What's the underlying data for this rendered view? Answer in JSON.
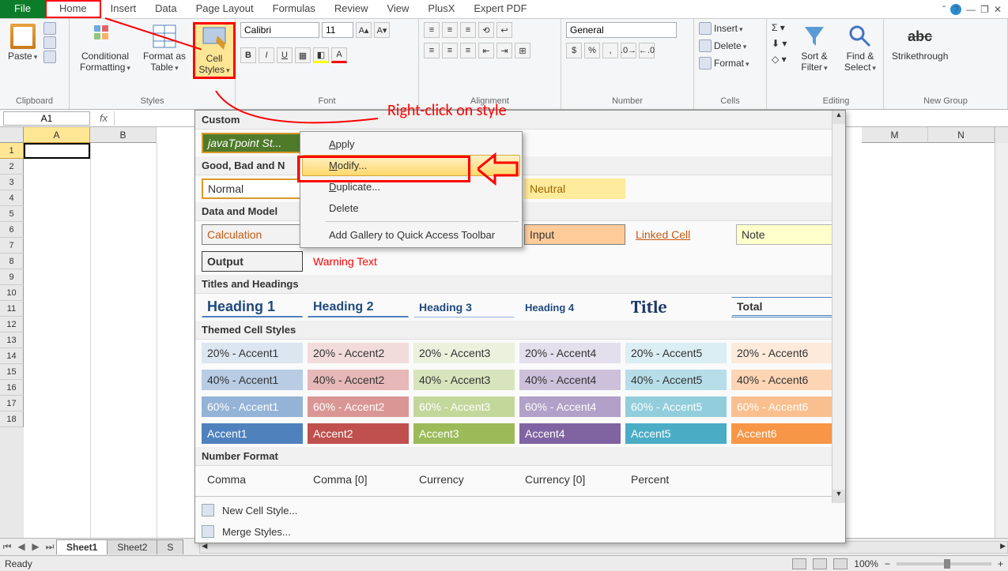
{
  "tabs": {
    "file": "File",
    "home": "Home",
    "insert": "Insert",
    "data": "Data",
    "pagelayout": "Page Layout",
    "formulas": "Formulas",
    "review": "Review",
    "view": "View",
    "plusx": "PlusX",
    "expertpdf": "Expert PDF"
  },
  "ribbon": {
    "clipboard": {
      "paste": "Paste",
      "label": "Clipboard"
    },
    "styles": {
      "cond": "Conditional Formatting",
      "asTable": "Format as Table",
      "cellStyles": "Cell Styles",
      "label": "Styles"
    },
    "font": {
      "name": "Calibri",
      "size": "11",
      "label": "Font",
      "bold": "B",
      "italic": "I",
      "underline": "U"
    },
    "alignment": {
      "label": "Alignment"
    },
    "number": {
      "general": "General",
      "label": "Number"
    },
    "cells": {
      "insert": "Insert",
      "delete": "Delete",
      "format": "Format",
      "label": "Cells"
    },
    "editing": {
      "sort": "Sort & Filter",
      "find": "Find & Select",
      "label": "Editing"
    },
    "newgroup": {
      "strike": "Strikethrough",
      "label": "New Group"
    }
  },
  "namebox": "A1",
  "columns": [
    "A",
    "B",
    "M",
    "N"
  ],
  "rows": [
    "1",
    "2",
    "3",
    "4",
    "5",
    "6",
    "7",
    "8",
    "9",
    "10",
    "11",
    "12",
    "13",
    "14",
    "15",
    "16",
    "17",
    "18"
  ],
  "sheets": {
    "s1": "Sheet1",
    "s2": "Sheet2",
    "s3": "S"
  },
  "status": {
    "ready": "Ready",
    "zoom": "100%"
  },
  "gallery": {
    "custom_hdr": "Custom",
    "custom_style": "javaTpoint St...",
    "gbn_hdr": "Good, Bad and N",
    "normal": "Normal",
    "neutral": "Neutral",
    "dm_hdr": "Data and Model",
    "calc": "Calculation",
    "input": "Input",
    "linked": "Linked Cell",
    "note": "Note",
    "output": "Output",
    "warning": "Warning Text",
    "th_hdr": "Titles and Headings",
    "h1": "Heading 1",
    "h2": "Heading 2",
    "h3": "Heading 3",
    "h4": "Heading 4",
    "title": "Title",
    "total": "Total",
    "themed_hdr": "Themed Cell Styles",
    "a20_1": "20% - Accent1",
    "a20_2": "20% - Accent2",
    "a20_3": "20% - Accent3",
    "a20_4": "20% - Accent4",
    "a20_5": "20% - Accent5",
    "a20_6": "20% - Accent6",
    "a40_1": "40% - Accent1",
    "a40_2": "40% - Accent2",
    "a40_3": "40% - Accent3",
    "a40_4": "40% - Accent4",
    "a40_5": "40% - Accent5",
    "a40_6": "40% - Accent6",
    "a60_1": "60% - Accent1",
    "a60_2": "60% - Accent2",
    "a60_3": "60% - Accent3",
    "a60_4": "60% - Accent4",
    "a60_5": "60% - Accent5",
    "a60_6": "60% - Accent6",
    "ac1": "Accent1",
    "ac2": "Accent2",
    "ac3": "Accent3",
    "ac4": "Accent4",
    "ac5": "Accent5",
    "ac6": "Accent6",
    "nf_hdr": "Number Format",
    "comma": "Comma",
    "comma0": "Comma [0]",
    "currency": "Currency",
    "currency0": "Currency [0]",
    "percent": "Percent",
    "newstyle": "New Cell Style...",
    "merge": "Merge Styles..."
  },
  "ctx": {
    "apply": "Apply",
    "modify": "Modify...",
    "duplicate": "Duplicate...",
    "delete": "Delete",
    "addqat": "Add Gallery to Quick Access Toolbar"
  },
  "anno": {
    "rightclick": "Right-click on style"
  }
}
